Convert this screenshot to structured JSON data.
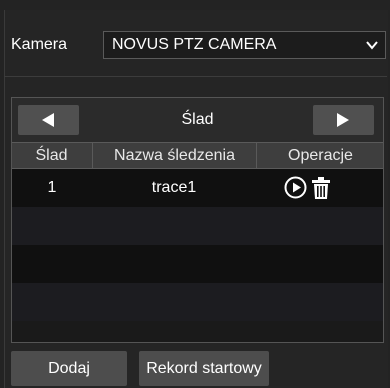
{
  "camera": {
    "label": "Kamera",
    "selected": "NOVUS PTZ CAMERA"
  },
  "trace_panel": {
    "title": "Ślad",
    "columns": [
      "Ślad",
      "Nazwa śledzenia",
      "Operacje"
    ],
    "rows": [
      {
        "id": "1",
        "name": "trace1"
      }
    ]
  },
  "buttons": {
    "add": "Dodaj",
    "start_record": "Rekord startowy"
  },
  "icons": {
    "prev": "triangle-left-icon",
    "next": "triangle-right-icon",
    "dropdown": "chevron-down-icon",
    "play": "play-circle-icon",
    "delete": "trash-icon"
  }
}
